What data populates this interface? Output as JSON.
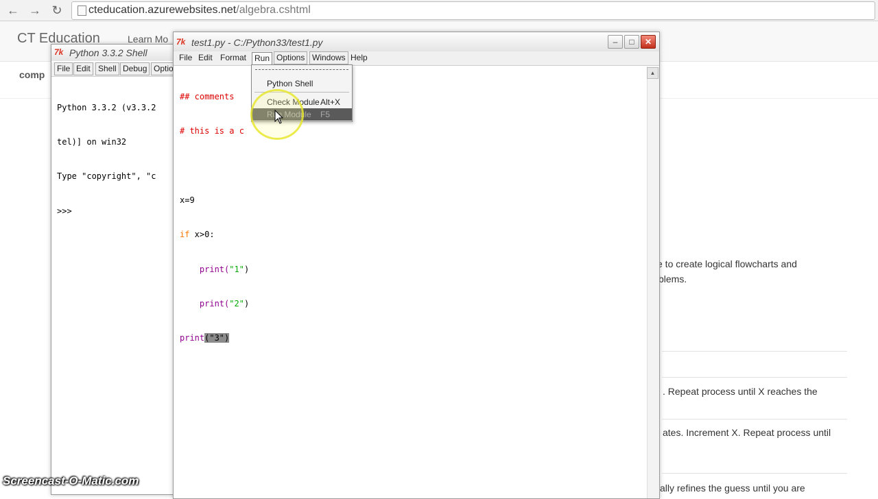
{
  "browser": {
    "url_host": "cteducation.azurewebsites.net",
    "url_path": "/algebra.cshtml"
  },
  "site": {
    "brand": "CT Education",
    "nav_partial": "Learn Mo",
    "side_partial": "comp",
    "text_lines": [
      "e to create logical flowcharts and",
      "blems.",
      ". Repeat process until X reaches the",
      "ates. Increment X. Repeat process until",
      "ally refines the guess until you are"
    ]
  },
  "shell": {
    "title": "Python 3.3.2 Shell",
    "icon": "7k",
    "menu": [
      "File",
      "Edit",
      "Shell",
      "Debug",
      "Optio"
    ],
    "lines": [
      "Python 3.3.2 (v3.3.2",
      "tel)] on win32",
      "Type \"copyright\", \"c",
      ">>> "
    ]
  },
  "editor": {
    "title": "test1.py - C:/Python33/test1.py",
    "icon": "7k",
    "menu": [
      "File",
      "Edit",
      "Format",
      "Run",
      "Options",
      "Windows",
      "Help"
    ],
    "active_menu": "Run",
    "code": {
      "c1": "## comments",
      "c2": "# this is a c",
      "l1": "x=9",
      "l2_kw": "if",
      "l2_rest": " x>0:",
      "l3_fn": "    print(",
      "l3_str": "\"1\"",
      "l3_end": ")",
      "l4_fn": "    print(",
      "l4_str": "\"2\"",
      "l4_end": ")",
      "l5_fn": "print",
      "l5_sel": "(\"3\")"
    },
    "colors": {
      "comment": "#dd0000",
      "keyword": "#ff7700",
      "builtin": "#900090",
      "string": "#00aa00"
    }
  },
  "run_menu": {
    "items": [
      {
        "label": "Python Shell",
        "accel": ""
      },
      {
        "label": "Check Module",
        "accel": "Alt+X"
      },
      {
        "label": "Run Module",
        "accel": "F5"
      }
    ]
  },
  "watermark": "Screencast-O-Matic.com"
}
